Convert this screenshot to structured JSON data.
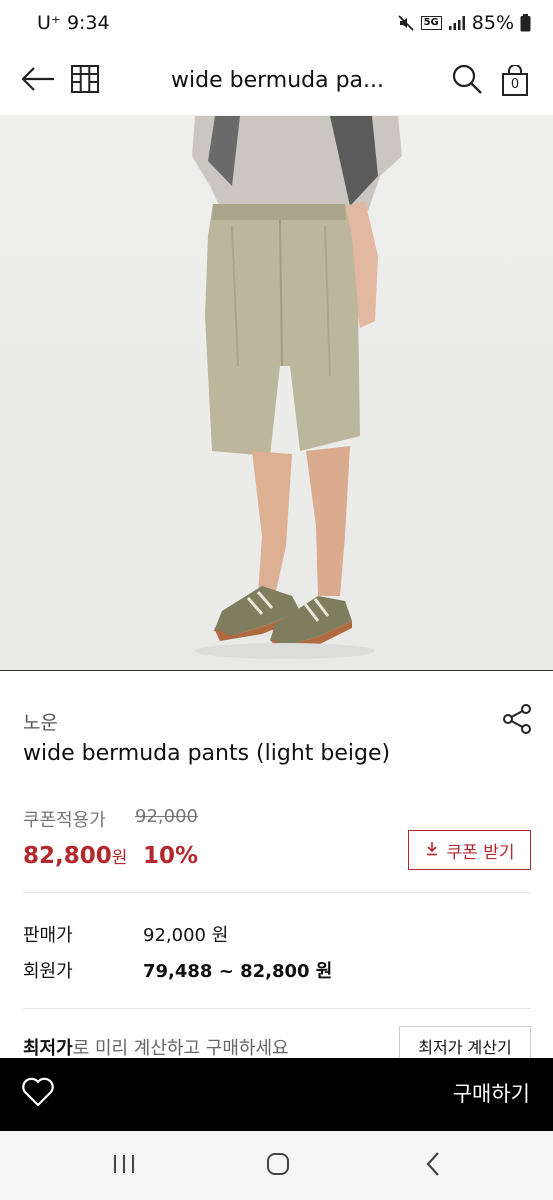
{
  "status_bar": {
    "carrier": "U⁺",
    "time": "9:34",
    "network": "5G",
    "battery": "85%"
  },
  "header": {
    "title": "wide bermuda pa...",
    "cart_count": "0",
    "back_icon": "arrow-left-icon",
    "home_icon": "store-icon",
    "search_icon": "search-icon",
    "cart_icon": "shopping-bag-icon"
  },
  "product": {
    "brand": "노운",
    "name": "wide bermuda pants (light beige)",
    "share_icon": "share-icon"
  },
  "price": {
    "coupon_label": "쿠폰적용가",
    "original": "92,000",
    "sale": "82,800",
    "sale_unit": "원",
    "discount": "10%",
    "coupon_button": "쿠폰 받기",
    "accent_color": "#b3282c"
  },
  "info": {
    "rows": [
      {
        "label": "판매가",
        "value": "92,000 원"
      },
      {
        "label": "회원가",
        "value": "79,488 ~ 82,800 원"
      }
    ]
  },
  "lowest": {
    "strong": "최저가",
    "rest": "로 미리 계산하고 구매하세요",
    "button": "최저가 계산기"
  },
  "buy_bar": {
    "wish_icon": "heart-icon",
    "buy_label": "구매하기"
  },
  "nav": {
    "recents_icon": "recents-icon",
    "home_icon": "home-circle-icon",
    "back_icon": "chevron-left-icon"
  }
}
